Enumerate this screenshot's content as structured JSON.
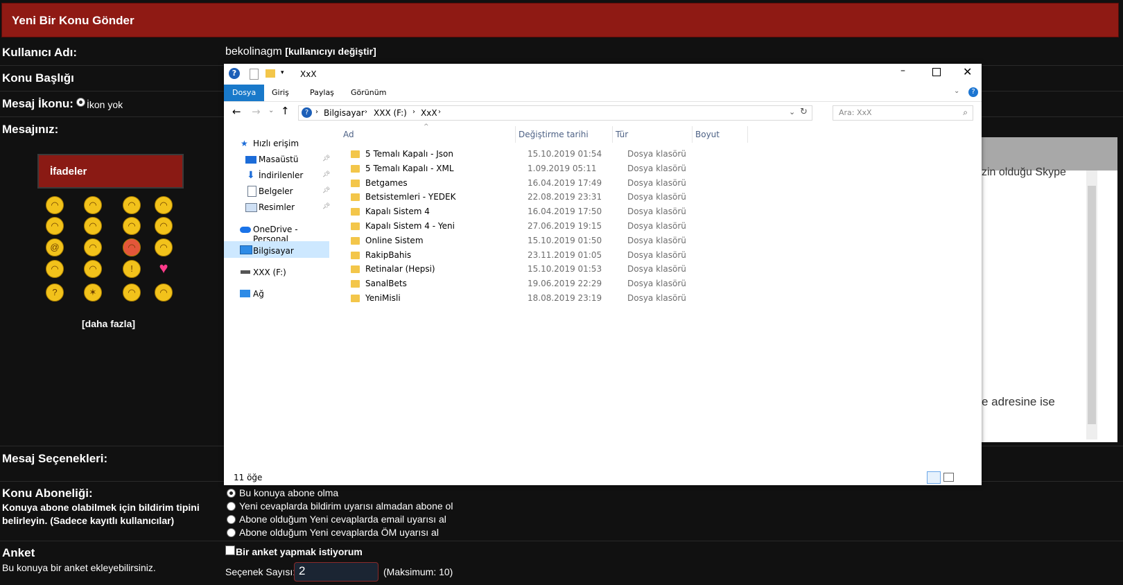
{
  "forum": {
    "header_title": "Yeni Bir Konu Gönder",
    "username_label": "Kullanıcı Adı:",
    "username_value": "bekolinagm",
    "change_user_link": "[kullanıcıyı değiştir]",
    "subject_label": "Konu Başlığı",
    "icon_label": "Mesaj İkonu:",
    "icon_none": "İkon yok",
    "message_label": "Mesajınız:",
    "emoticons_title": "İfadeler",
    "emoticons_more": "[daha fazla]",
    "emoticon_faces": [
      "smile-icon",
      "grin-icon",
      "cool-icon",
      "biggrin-icon",
      "tongue-icon",
      "wink-icon",
      "eek-icon",
      "confused-icon",
      "at-icon",
      "angel-icon",
      "mad-icon",
      "thinking-icon",
      "sleepy-icon",
      "nerd-icon",
      "exclamation-icon",
      "heart-icon",
      "question-icon",
      "idea-icon",
      "relaxed-icon",
      "hmm-icon"
    ],
    "editor_text_1": "zin olduğu Skype",
    "editor_text_2": "e adresine ise",
    "options_label": "Mesaj Seçenekleri:",
    "subscription_label": "Konu Aboneliği:",
    "subscription_desc": "Konuya abone olabilmek için bildirim tipini belirleyin. (Sadece kayıtlı kullanıcılar)",
    "subscription_options": [
      "Bu konuya abone olma",
      "Yeni cevaplarda bildirim uyarısı almadan abone ol",
      "Abone olduğum Yeni cevaplarda email uyarısı al",
      "Abone olduğum Yeni cevaplarda ÖM uyarısı al"
    ],
    "poll_label": "Anket",
    "poll_desc": "Bu konuya bir anket ekleyebilirsiniz.",
    "poll_checkbox": "Bir anket yapmak istiyorum",
    "poll_count_label": "Seçenek Sayısı:",
    "poll_count_value": "2",
    "poll_max": "(Maksimum: 10)"
  },
  "explorer": {
    "title": "XxX",
    "tabs": [
      "Dosya",
      "Giriş",
      "Paylaş",
      "Görünüm"
    ],
    "path": [
      "Bilgisayar",
      "XXX (F:)",
      "XxX"
    ],
    "search_placeholder": "Ara: XxX",
    "nav_items": [
      {
        "label": "Hızlı erişim",
        "icon": "star-icon"
      },
      {
        "label": "Masaüstü",
        "icon": "desktop-icon"
      },
      {
        "label": "İndirilenler",
        "icon": "download-icon"
      },
      {
        "label": "Belgeler",
        "icon": "documents-icon"
      },
      {
        "label": "Resimler",
        "icon": "pictures-icon"
      },
      {
        "label": "OneDrive - Personal",
        "icon": "cloud-icon"
      },
      {
        "label": "Bilgisayar",
        "icon": "computer-icon"
      },
      {
        "label": "XXX (F:)",
        "icon": "drive-icon"
      },
      {
        "label": "Ağ",
        "icon": "network-icon"
      }
    ],
    "columns": [
      "Ad",
      "Değiştirme tarihi",
      "Tür",
      "Boyut"
    ],
    "files": [
      {
        "name": "5 Temalı Kapalı - Json",
        "date": "15.10.2019 01:54",
        "type": "Dosya klasörü"
      },
      {
        "name": "5 Temalı Kapalı - XML",
        "date": "1.09.2019 05:11",
        "type": "Dosya klasörü"
      },
      {
        "name": "Betgames",
        "date": "16.04.2019 17:49",
        "type": "Dosya klasörü"
      },
      {
        "name": "Betsistemleri - YEDEK",
        "date": "22.08.2019 23:31",
        "type": "Dosya klasörü"
      },
      {
        "name": "Kapalı Sistem 4",
        "date": "16.04.2019 17:50",
        "type": "Dosya klasörü"
      },
      {
        "name": "Kapalı Sistem 4 - Yeni",
        "date": "27.06.2019 19:15",
        "type": "Dosya klasörü"
      },
      {
        "name": "Online Sistem",
        "date": "15.10.2019 01:50",
        "type": "Dosya klasörü"
      },
      {
        "name": "RakipBahis",
        "date": "23.11.2019 01:05",
        "type": "Dosya klasörü"
      },
      {
        "name": "Retinalar (Hepsi)",
        "date": "15.10.2019 01:53",
        "type": "Dosya klasörü"
      },
      {
        "name": "SanalBets",
        "date": "19.06.2019 22:29",
        "type": "Dosya klasörü"
      },
      {
        "name": "YeniMisli",
        "date": "18.08.2019 23:19",
        "type": "Dosya klasörü"
      }
    ],
    "status": "11 öğe"
  }
}
